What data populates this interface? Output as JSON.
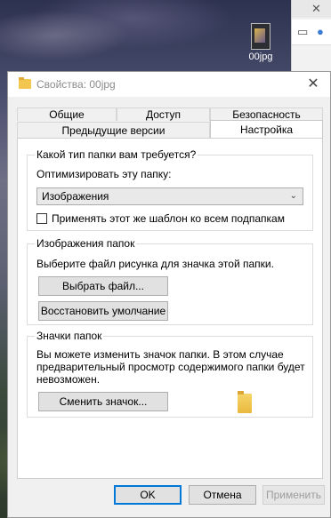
{
  "desktop": {
    "icon_label": "00jpg"
  },
  "dialog": {
    "title": "Свойства: 00jpg",
    "tabs_row1": [
      "Общие",
      "Доступ",
      "Безопасность"
    ],
    "tabs_row2": [
      "Предыдущие версии",
      "Настройка"
    ],
    "active_tab": "Настройка",
    "folder_type": {
      "heading": "Какой тип папки вам требуется?",
      "optimize_label": "Оптимизировать эту папку:",
      "selected_option": "Изображения",
      "apply_checkbox_label": "Применять этот же шаблон ко всем подпапкам",
      "apply_checked": false
    },
    "folder_pictures": {
      "heading": "Изображения папок",
      "description": "Выберите файл рисунка для значка этой папки.",
      "choose_file_button": "Выбрать файл...",
      "restore_default_button": "Восстановить умолчание"
    },
    "folder_icons": {
      "heading": "Значки папок",
      "description_line1": "Вы можете изменить значок папки. В этом случае",
      "description_line2": "предварительный просмотр содержимого папки будет",
      "description_line3": "невозможен.",
      "change_icon_button": "Сменить значок..."
    },
    "buttons": {
      "ok": "OK",
      "cancel": "Отмена",
      "apply": "Применить"
    }
  }
}
